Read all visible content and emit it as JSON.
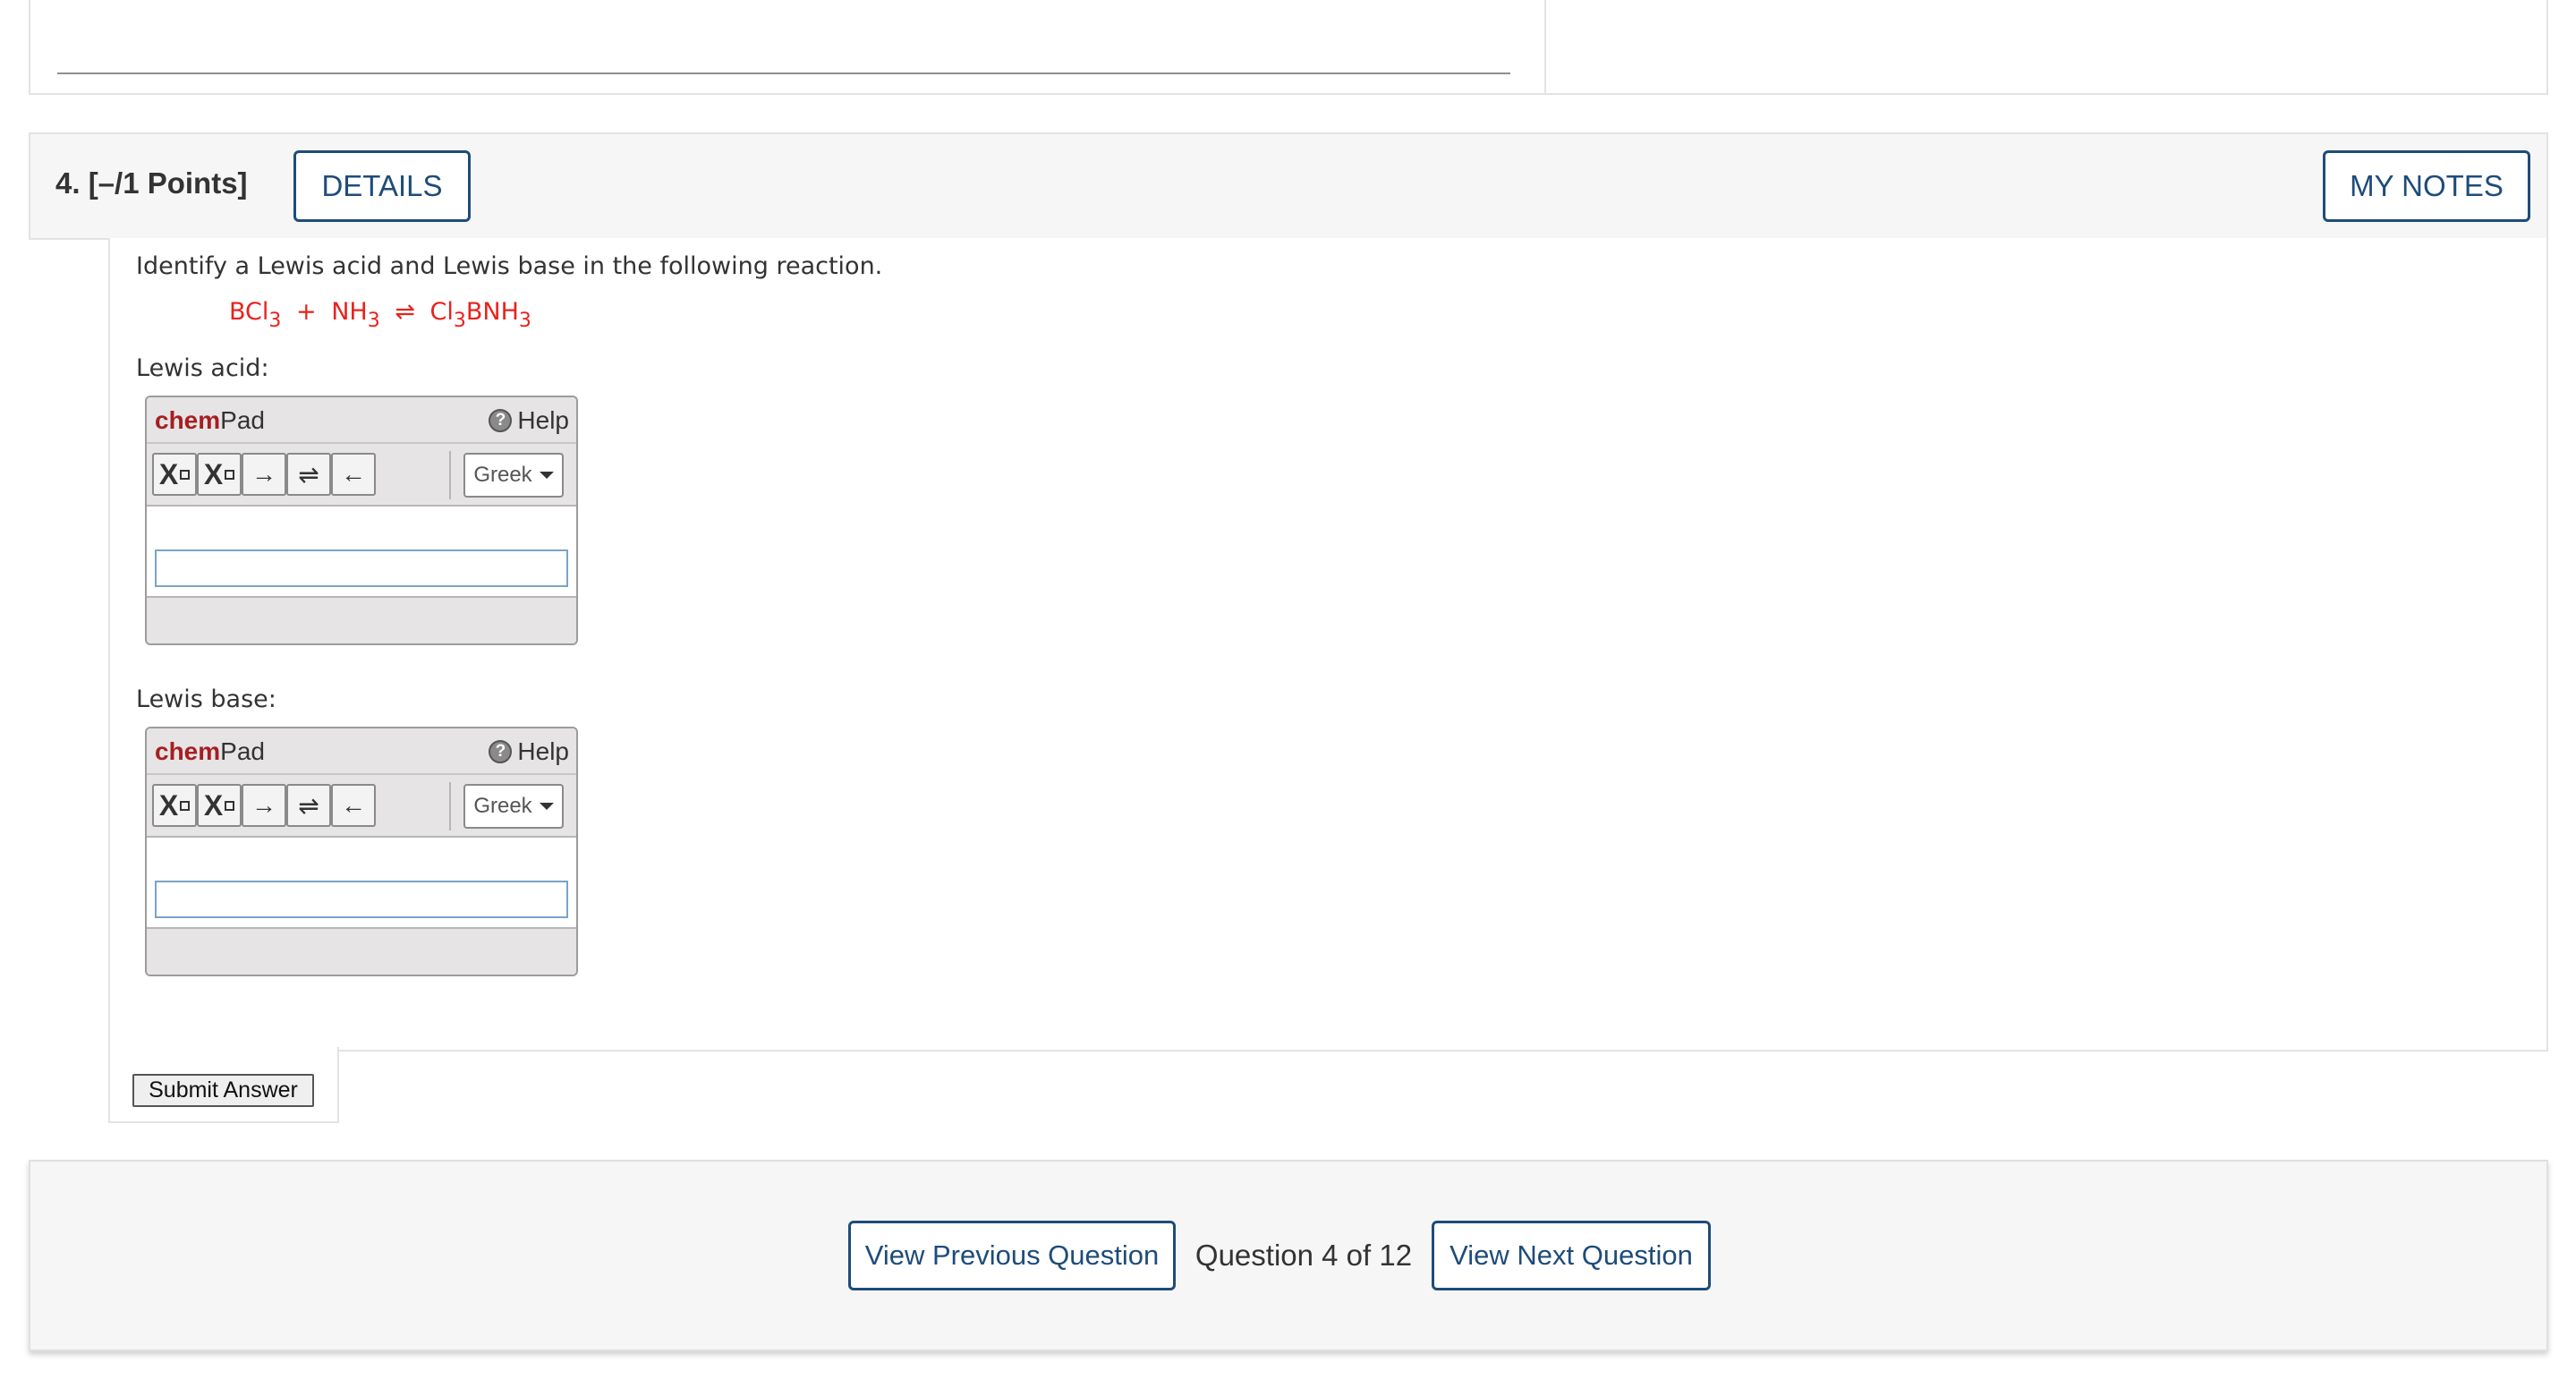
{
  "question": {
    "number_points": "4.  [–/1 Points]",
    "details_label": "DETAILS",
    "mynotes_label": "MY NOTES",
    "prompt": "Identify a Lewis acid and Lewis base in the following reaction.",
    "equation": {
      "r1": "BCl",
      "r1_sub": "3",
      "plus": "+",
      "r2": "NH",
      "r2_sub": "3",
      "arrow": "⇌",
      "p_a": "Cl",
      "p_a_sub": "3",
      "p_b": "BNH",
      "p_b_sub": "3",
      "color": "#e8221d"
    },
    "acid_label": "Lewis acid:",
    "base_label": "Lewis base:",
    "submit_label": "Submit Answer"
  },
  "chempad": {
    "brand_bold": "chem",
    "brand_rest": "Pad",
    "brand_color": "#a61e22",
    "help_label": "Help",
    "tools": {
      "subscript_letter": "X",
      "superscript_letter": "X",
      "right_arrow": "→",
      "equilibrium_arrow": "⇌",
      "left_arrow": "←"
    },
    "greek_label": "Greek",
    "acid_value": "",
    "base_value": ""
  },
  "nav": {
    "prev_label": "View Previous Question",
    "counter": "Question 4 of 12",
    "next_label": "View Next Question",
    "accent_color": "#1e4c7a"
  }
}
